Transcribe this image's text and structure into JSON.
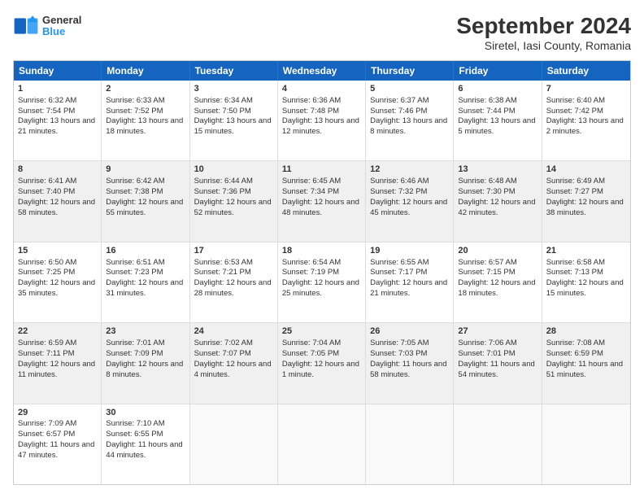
{
  "header": {
    "logo_line1": "General",
    "logo_line2": "Blue",
    "title": "September 2024",
    "subtitle": "Siretel, Iasi County, Romania"
  },
  "calendar": {
    "days": [
      "Sunday",
      "Monday",
      "Tuesday",
      "Wednesday",
      "Thursday",
      "Friday",
      "Saturday"
    ],
    "rows": [
      [
        {
          "num": "1",
          "rise": "Sunrise: 6:32 AM",
          "set": "Sunset: 7:54 PM",
          "day": "Daylight: 13 hours and 21 minutes.",
          "shade": false
        },
        {
          "num": "2",
          "rise": "Sunrise: 6:33 AM",
          "set": "Sunset: 7:52 PM",
          "day": "Daylight: 13 hours and 18 minutes.",
          "shade": false
        },
        {
          "num": "3",
          "rise": "Sunrise: 6:34 AM",
          "set": "Sunset: 7:50 PM",
          "day": "Daylight: 13 hours and 15 minutes.",
          "shade": false
        },
        {
          "num": "4",
          "rise": "Sunrise: 6:36 AM",
          "set": "Sunset: 7:48 PM",
          "day": "Daylight: 13 hours and 12 minutes.",
          "shade": false
        },
        {
          "num": "5",
          "rise": "Sunrise: 6:37 AM",
          "set": "Sunset: 7:46 PM",
          "day": "Daylight: 13 hours and 8 minutes.",
          "shade": false
        },
        {
          "num": "6",
          "rise": "Sunrise: 6:38 AM",
          "set": "Sunset: 7:44 PM",
          "day": "Daylight: 13 hours and 5 minutes.",
          "shade": false
        },
        {
          "num": "7",
          "rise": "Sunrise: 6:40 AM",
          "set": "Sunset: 7:42 PM",
          "day": "Daylight: 13 hours and 2 minutes.",
          "shade": false
        }
      ],
      [
        {
          "num": "8",
          "rise": "Sunrise: 6:41 AM",
          "set": "Sunset: 7:40 PM",
          "day": "Daylight: 12 hours and 58 minutes.",
          "shade": true
        },
        {
          "num": "9",
          "rise": "Sunrise: 6:42 AM",
          "set": "Sunset: 7:38 PM",
          "day": "Daylight: 12 hours and 55 minutes.",
          "shade": true
        },
        {
          "num": "10",
          "rise": "Sunrise: 6:44 AM",
          "set": "Sunset: 7:36 PM",
          "day": "Daylight: 12 hours and 52 minutes.",
          "shade": true
        },
        {
          "num": "11",
          "rise": "Sunrise: 6:45 AM",
          "set": "Sunset: 7:34 PM",
          "day": "Daylight: 12 hours and 48 minutes.",
          "shade": true
        },
        {
          "num": "12",
          "rise": "Sunrise: 6:46 AM",
          "set": "Sunset: 7:32 PM",
          "day": "Daylight: 12 hours and 45 minutes.",
          "shade": true
        },
        {
          "num": "13",
          "rise": "Sunrise: 6:48 AM",
          "set": "Sunset: 7:30 PM",
          "day": "Daylight: 12 hours and 42 minutes.",
          "shade": true
        },
        {
          "num": "14",
          "rise": "Sunrise: 6:49 AM",
          "set": "Sunset: 7:27 PM",
          "day": "Daylight: 12 hours and 38 minutes.",
          "shade": true
        }
      ],
      [
        {
          "num": "15",
          "rise": "Sunrise: 6:50 AM",
          "set": "Sunset: 7:25 PM",
          "day": "Daylight: 12 hours and 35 minutes.",
          "shade": false
        },
        {
          "num": "16",
          "rise": "Sunrise: 6:51 AM",
          "set": "Sunset: 7:23 PM",
          "day": "Daylight: 12 hours and 31 minutes.",
          "shade": false
        },
        {
          "num": "17",
          "rise": "Sunrise: 6:53 AM",
          "set": "Sunset: 7:21 PM",
          "day": "Daylight: 12 hours and 28 minutes.",
          "shade": false
        },
        {
          "num": "18",
          "rise": "Sunrise: 6:54 AM",
          "set": "Sunset: 7:19 PM",
          "day": "Daylight: 12 hours and 25 minutes.",
          "shade": false
        },
        {
          "num": "19",
          "rise": "Sunrise: 6:55 AM",
          "set": "Sunset: 7:17 PM",
          "day": "Daylight: 12 hours and 21 minutes.",
          "shade": false
        },
        {
          "num": "20",
          "rise": "Sunrise: 6:57 AM",
          "set": "Sunset: 7:15 PM",
          "day": "Daylight: 12 hours and 18 minutes.",
          "shade": false
        },
        {
          "num": "21",
          "rise": "Sunrise: 6:58 AM",
          "set": "Sunset: 7:13 PM",
          "day": "Daylight: 12 hours and 15 minutes.",
          "shade": false
        }
      ],
      [
        {
          "num": "22",
          "rise": "Sunrise: 6:59 AM",
          "set": "Sunset: 7:11 PM",
          "day": "Daylight: 12 hours and 11 minutes.",
          "shade": true
        },
        {
          "num": "23",
          "rise": "Sunrise: 7:01 AM",
          "set": "Sunset: 7:09 PM",
          "day": "Daylight: 12 hours and 8 minutes.",
          "shade": true
        },
        {
          "num": "24",
          "rise": "Sunrise: 7:02 AM",
          "set": "Sunset: 7:07 PM",
          "day": "Daylight: 12 hours and 4 minutes.",
          "shade": true
        },
        {
          "num": "25",
          "rise": "Sunrise: 7:04 AM",
          "set": "Sunset: 7:05 PM",
          "day": "Daylight: 12 hours and 1 minute.",
          "shade": true
        },
        {
          "num": "26",
          "rise": "Sunrise: 7:05 AM",
          "set": "Sunset: 7:03 PM",
          "day": "Daylight: 11 hours and 58 minutes.",
          "shade": true
        },
        {
          "num": "27",
          "rise": "Sunrise: 7:06 AM",
          "set": "Sunset: 7:01 PM",
          "day": "Daylight: 11 hours and 54 minutes.",
          "shade": true
        },
        {
          "num": "28",
          "rise": "Sunrise: 7:08 AM",
          "set": "Sunset: 6:59 PM",
          "day": "Daylight: 11 hours and 51 minutes.",
          "shade": true
        }
      ],
      [
        {
          "num": "29",
          "rise": "Sunrise: 7:09 AM",
          "set": "Sunset: 6:57 PM",
          "day": "Daylight: 11 hours and 47 minutes.",
          "shade": false
        },
        {
          "num": "30",
          "rise": "Sunrise: 7:10 AM",
          "set": "Sunset: 6:55 PM",
          "day": "Daylight: 11 hours and 44 minutes.",
          "shade": false
        },
        {
          "num": "",
          "rise": "",
          "set": "",
          "day": "",
          "shade": false,
          "empty": true
        },
        {
          "num": "",
          "rise": "",
          "set": "",
          "day": "",
          "shade": false,
          "empty": true
        },
        {
          "num": "",
          "rise": "",
          "set": "",
          "day": "",
          "shade": false,
          "empty": true
        },
        {
          "num": "",
          "rise": "",
          "set": "",
          "day": "",
          "shade": false,
          "empty": true
        },
        {
          "num": "",
          "rise": "",
          "set": "",
          "day": "",
          "shade": false,
          "empty": true
        }
      ]
    ]
  }
}
